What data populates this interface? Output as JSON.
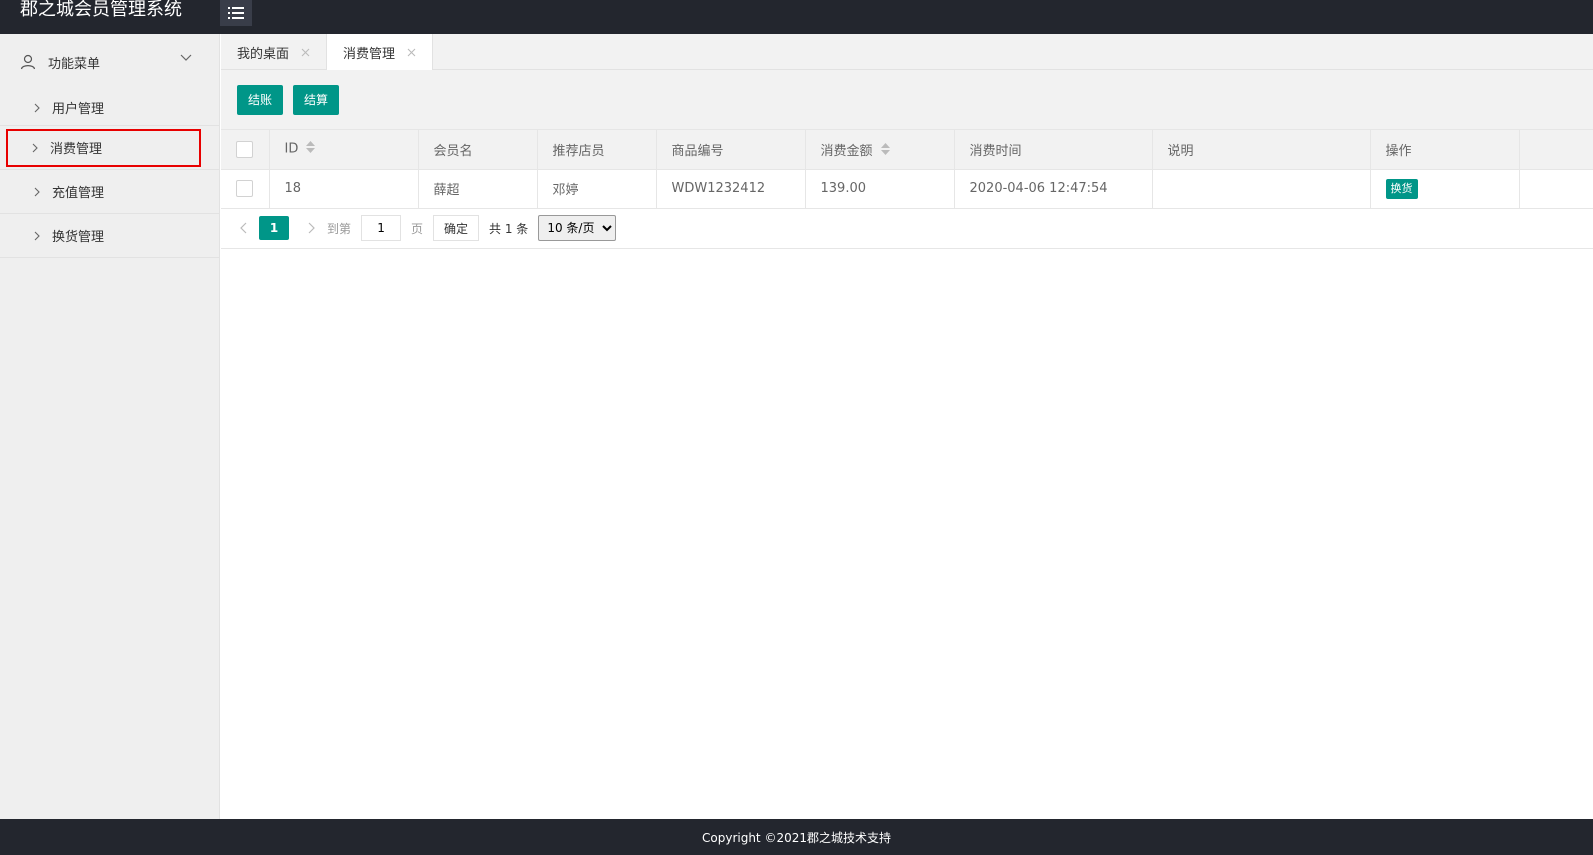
{
  "app": {
    "title": "郡之城会员管理系统"
  },
  "sidebar": {
    "group_label": "功能菜单",
    "items": [
      {
        "label": "用户管理"
      },
      {
        "label": "消费管理"
      },
      {
        "label": "充值管理"
      },
      {
        "label": "换货管理"
      }
    ]
  },
  "tabs": [
    {
      "label": "我的桌面"
    },
    {
      "label": "消费管理"
    }
  ],
  "toolbar": {
    "checkout_label": "结账",
    "settle_label": "结算"
  },
  "table": {
    "headers": [
      "ID",
      "会员名",
      "推荐店员",
      "商品编号",
      "消费金额",
      "消费时间",
      "说明",
      "操作"
    ],
    "rows": [
      {
        "id": "18",
        "member": "薛超",
        "staff": "邓婷",
        "product_code": "WDW1232412",
        "amount": "139.00",
        "time": "2020-04-06 12:47:54",
        "note": "",
        "action": "换货"
      }
    ]
  },
  "pager": {
    "current_page": "1",
    "goto_label": "到第",
    "goto_value": "1",
    "page_suffix": "页",
    "confirm_label": "确定",
    "total_label": "共 1 条",
    "page_size": "10 条/页"
  },
  "footer": {
    "copyright": "Copyright ©2021郡之城技术支持"
  },
  "colors": {
    "header_bg": "#23262e",
    "accent": "#009688",
    "highlight": "#e80000"
  }
}
